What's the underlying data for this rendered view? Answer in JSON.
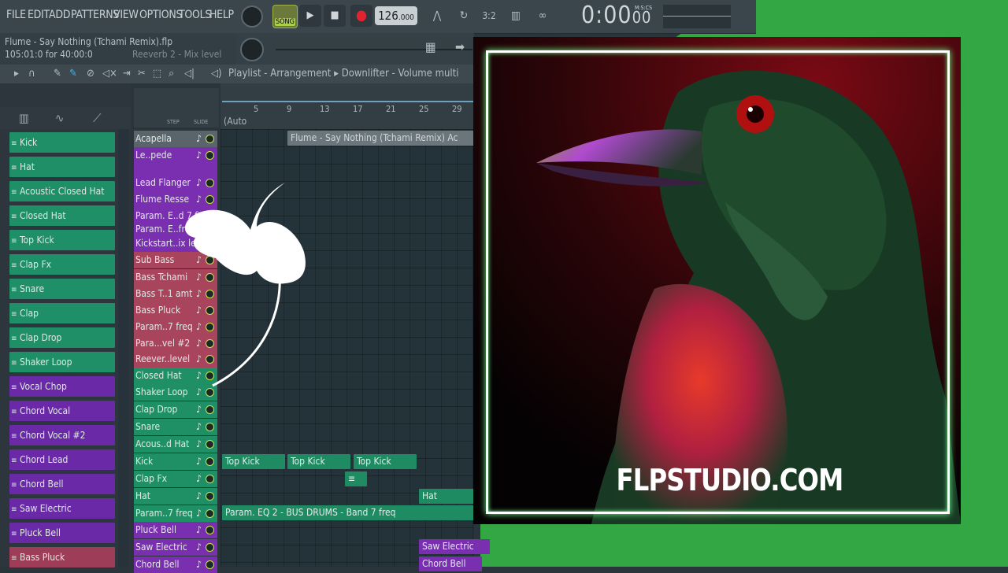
{
  "menu": {
    "items": [
      "FILE",
      "EDIT",
      "ADD",
      "PATTERNS",
      "VIEW",
      "OPTIONS",
      "TOOLS",
      "HELP"
    ]
  },
  "hint_panel": {
    "song_title": "Flume - Say Nothing (Tchami Remix).flp",
    "position_text": "105:01:0 for 40:00:0",
    "mixer_hint": "Reeverb 2 - Mix level"
  },
  "transport": {
    "song_label": "SONG",
    "tempo_main": "126",
    "tempo_frac": ".000",
    "time_main": "0:00",
    "time_frac": "00",
    "time_format": "M:S:CS"
  },
  "playlist": {
    "title": "Playlist - Arrangement",
    "pattern": "Downlifter - Volume multi",
    "auto_label": "(Auto",
    "step_label": "STEP",
    "slide_label": "SLIDE",
    "ticks": [
      "5",
      "9",
      "13",
      "17",
      "21",
      "25",
      "29"
    ]
  },
  "channels": [
    {
      "label": "Kick",
      "color": "green"
    },
    {
      "label": "Hat",
      "color": "green"
    },
    {
      "label": "Acoustic Closed Hat",
      "color": "green"
    },
    {
      "label": "Closed Hat",
      "color": "green"
    },
    {
      "label": "Top Kick",
      "color": "green"
    },
    {
      "label": "Clap Fx",
      "color": "green"
    },
    {
      "label": "Snare",
      "color": "green"
    },
    {
      "label": "Clap",
      "color": "green"
    },
    {
      "label": "Clap Drop",
      "color": "green"
    },
    {
      "label": "Shaker Loop",
      "color": "green"
    },
    {
      "label": "Vocal Chop",
      "color": "purple"
    },
    {
      "label": "Chord Vocal",
      "color": "purple"
    },
    {
      "label": "Chord Vocal #2",
      "color": "purple"
    },
    {
      "label": "Chord Lead",
      "color": "purple"
    },
    {
      "label": "Chord Bell",
      "color": "purple"
    },
    {
      "label": "Saw Electric",
      "color": "purple"
    },
    {
      "label": "Pluck Bell",
      "color": "purple"
    },
    {
      "label": "Bass Pluck",
      "color": "pink"
    }
  ],
  "tracks": [
    {
      "label": "Acapella",
      "color": "gray"
    },
    {
      "label": "Le..pede",
      "color": "purple"
    },
    {
      "label": "",
      "color": "purple"
    },
    {
      "label": "Lead Flanger",
      "color": "purple"
    },
    {
      "label": "Flume Resse",
      "color": "purple"
    },
    {
      "label": "Param. E..d 7 f",
      "color": "purple"
    },
    {
      "label": "Param. E..freq",
      "color": "purple"
    },
    {
      "label": "Kickstart..ix level",
      "color": "purple"
    },
    {
      "label": "Sub Bass",
      "color": "pink"
    },
    {
      "label": "Bass Tchami",
      "color": "pink"
    },
    {
      "label": "Bass T..1 amt",
      "color": "pink"
    },
    {
      "label": "Bass Pluck",
      "color": "pink"
    },
    {
      "label": "Param..7 freq",
      "color": "pink"
    },
    {
      "label": "Para...vel #2",
      "color": "pink"
    },
    {
      "label": "Reever..level",
      "color": "pink"
    },
    {
      "label": "Closed Hat",
      "color": "green"
    },
    {
      "label": "Shaker Loop",
      "color": "green"
    },
    {
      "label": "Clap Drop",
      "color": "green"
    },
    {
      "label": "Snare",
      "color": "green"
    },
    {
      "label": "Acous..d Hat",
      "color": "green"
    },
    {
      "label": "Kick",
      "color": "green"
    },
    {
      "label": "Clap Fx",
      "color": "green"
    },
    {
      "label": "Hat",
      "color": "green"
    },
    {
      "label": "Param..7 freq",
      "color": "green"
    },
    {
      "label": "Pluck Bell",
      "color": "purple"
    },
    {
      "label": "Saw Electric",
      "color": "purple"
    },
    {
      "label": "Chord Bell",
      "color": "purple"
    }
  ],
  "clips": {
    "acapella": "Flume - Say Nothing (Tchami Remix) Ac",
    "top_kick_1": "Top Kick",
    "top_kick_2": "Top Kick",
    "top_kick_3": "Top Kick",
    "hat": "Hat",
    "param_eq": "Param. EQ 2 - BUS DRUMS - Band 7 freq",
    "saw_electric": "Saw Electric",
    "chord_bell": "Chord Bell"
  },
  "artwork": {
    "site_label": "FLPSTUDIO.COM"
  },
  "colors": {
    "green_bg": "#33a744",
    "channel_green": "#1e8f66",
    "channel_purple": "#6a2aa8",
    "channel_pink": "#9e3d57",
    "frame_glow": "#6cff8a"
  }
}
